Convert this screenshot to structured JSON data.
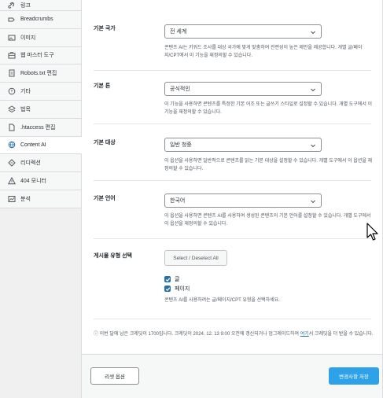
{
  "sidebar": {
    "items": [
      {
        "label": "링크",
        "icon": "link-icon"
      },
      {
        "label": "Breadcrumbs",
        "icon": "breadcrumbs-icon"
      },
      {
        "label": "이미지",
        "icon": "image-icon"
      },
      {
        "label": "웹 마스터 도구",
        "icon": "toolbox-icon"
      },
      {
        "label": "Robots.txt 편집",
        "icon": "document-icon"
      },
      {
        "label": "기타",
        "icon": "circle-icon"
      },
      {
        "label": "법목",
        "icon": "layers-icon"
      },
      {
        "label": ".htaccess 편집",
        "icon": "file-icon"
      },
      {
        "label": "Content AI",
        "icon": "globe-icon"
      },
      {
        "label": "리디렉션",
        "icon": "redirect-icon"
      },
      {
        "label": "404 모니터",
        "icon": "warning-icon"
      },
      {
        "label": "분석",
        "icon": "chart-icon"
      }
    ]
  },
  "settings": {
    "country": {
      "label": "기본 국가",
      "value": "전 세계",
      "desc": "콘텐츠 AI는 키워드 조사를 대상 국가에 맞게 맞춤하여 관련성이 높은 제안을 제공합니다. 개별 글/페이지/CPT에서 이 기능을 재정의할 수 있습니다."
    },
    "tone": {
      "label": "기본 톤",
      "value": "공식적인",
      "desc": "이 기능을 사용하면 콘텐츠를 특정한 기본 어조 또는 글쓰기 스타일로 설정할 수 있습니다. 개별 도구에서 이 기능을 재정의할 수 있습니다."
    },
    "audience": {
      "label": "기본 대상",
      "value": "일반 청중",
      "desc": "이 옵션을 사용하면 일반적으로 콘텐츠를 읽는 기본 대상을 설정할 수 있습니다. 개별 도구에서 이 옵션을 재정의할 수 있습니다."
    },
    "language": {
      "label": "기본 언어",
      "value": "한국어",
      "desc": "이 옵션을 사용하면 콘텐츠 AI를 사용하여 생성된 콘텐츠의 기본 언어를 설정할 수 있습니다. 개별 도구에서 이 옵션을 재정의할 수 있습니다."
    },
    "post_types": {
      "label": "게시물 유형 선택",
      "button": "Select / Deselect All",
      "options": [
        {
          "label": "글",
          "checked": true
        },
        {
          "label": "페이지",
          "checked": true
        }
      ],
      "desc": "콘텐츠 AI를 사용하려는 글/페이지/CPT 유형을 선택하세요."
    }
  },
  "notice": {
    "text": "ⓘ 이번 달에 남은 크레딧이 1700입니다. 크레딧이 2024. 12. 13 9:00 오전에 갱신되거나 업그레이드하여 ",
    "link": "여기",
    "text_end": "서 크레딧을 더 받을 수 있습니다."
  },
  "footer": {
    "reset_label": "리셋 옵션",
    "save_label": "변경사항 저장"
  },
  "colors": {
    "accent": "#2271b1",
    "save_button": "#2ea2e8"
  }
}
